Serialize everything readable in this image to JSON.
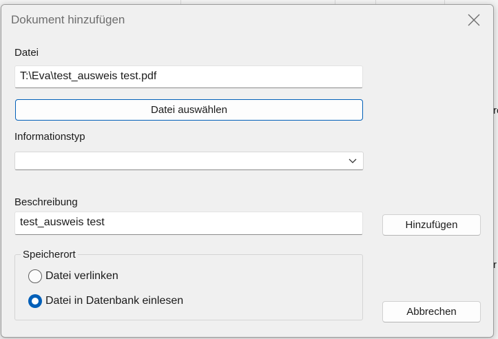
{
  "background": {
    "fragment_top": "re",
    "fragment_bottom": "r"
  },
  "dialog": {
    "title": "Dokument hinzufügen",
    "close_icon": "close-icon"
  },
  "file": {
    "label": "Datei",
    "value": "T:\\Eva\\test_ausweis test.pdf",
    "choose_button": "Datei auswählen"
  },
  "info_type": {
    "label": "Informationstyp",
    "selected": "",
    "icon": "chevron-down-icon"
  },
  "description": {
    "label": "Beschreibung",
    "value": "test_ausweis test"
  },
  "storage": {
    "legend": "Speicherort",
    "options": [
      {
        "label": "Datei verlinken",
        "selected": false
      },
      {
        "label": "Datei in Datenbank einlesen",
        "selected": true
      }
    ]
  },
  "actions": {
    "add": "Hinzufügen",
    "cancel": "Abbrechen"
  },
  "colors": {
    "accent": "#005fb8",
    "dialog_bg": "#f0f0f0"
  }
}
